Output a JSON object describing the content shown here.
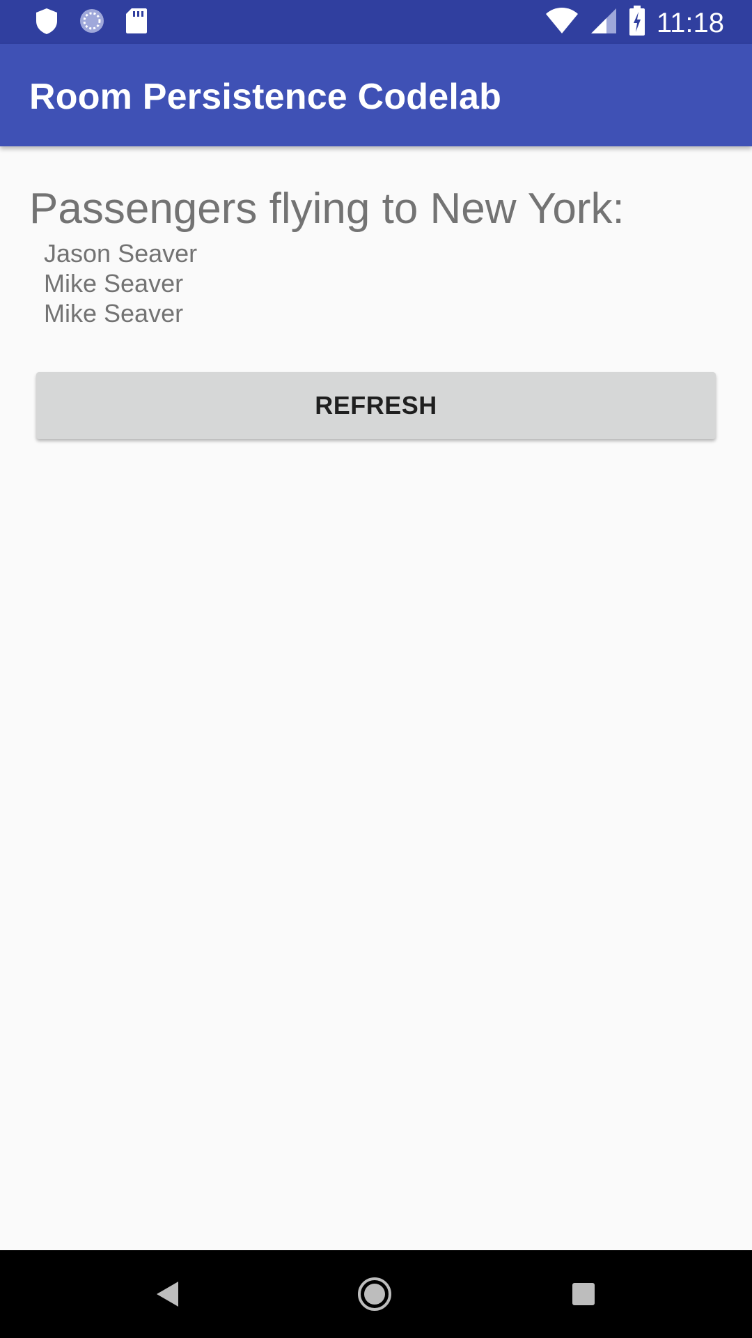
{
  "status_bar": {
    "time": "11:18",
    "left_icons": [
      "shield-icon",
      "sync-icon",
      "sd-card-icon"
    ],
    "right_icons": [
      "wifi-icon",
      "cell-signal-icon",
      "battery-charging-icon"
    ]
  },
  "app_bar": {
    "title": "Room Persistence Codelab",
    "color": "#3f51b5"
  },
  "main": {
    "heading": "Passengers flying to New York:",
    "passengers": [
      "Jason Seaver",
      "Mike Seaver",
      "Mike Seaver"
    ],
    "refresh_label": "REFRESH"
  },
  "nav_bar": {
    "icons": [
      "back-icon",
      "home-icon",
      "recents-icon"
    ]
  }
}
